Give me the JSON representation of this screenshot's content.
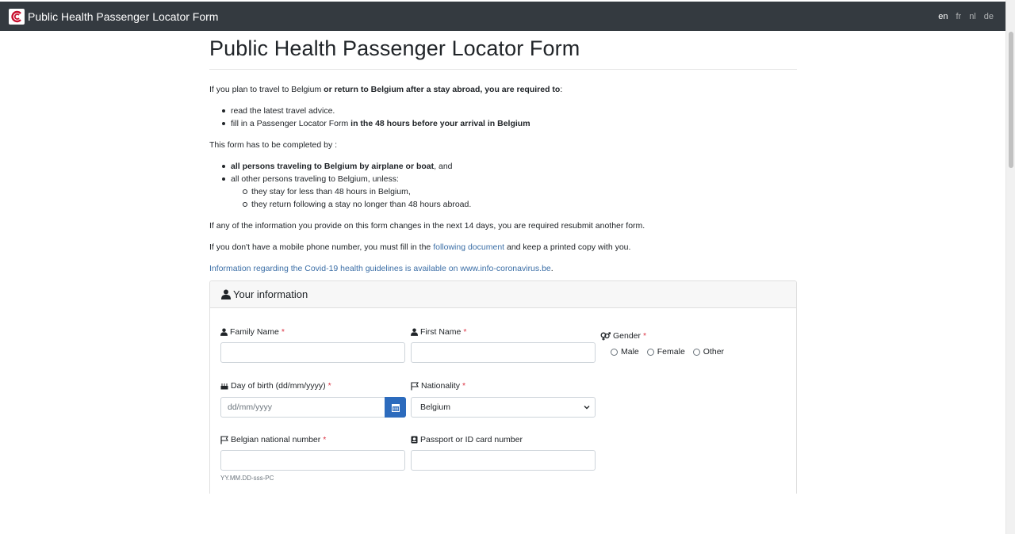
{
  "navbar": {
    "brand": "Public Health Passenger Locator Form",
    "languages": [
      "en",
      "fr",
      "nl",
      "de"
    ],
    "active_language": "en"
  },
  "page": {
    "title": "Public Health Passenger Locator Form",
    "intro_a": "If you plan to travel to Belgium ",
    "intro_b": "or return to Belgium after a stay abroad, you are required to",
    "intro_c": ":",
    "req1": "read the latest travel advice.",
    "req2_a": "fill in a Passenger Locator Form ",
    "req2_b": "in the 48 hours before your arrival in Belgium",
    "completed_by": "This form has to be completed by :",
    "cb1_a": "all persons traveling to Belgium by airplane or boat",
    "cb1_b": ", and",
    "cb2": "all other persons traveling to Belgium, unless:",
    "ex1": "they stay for less than 48 hours in Belgium,",
    "ex2": "they return following a stay no longer than 48 hours abroad.",
    "changes": "If any of the information you provide on this form changes in the next 14 days, you are required resubmit another form.",
    "nophone_a": "If you don't have a mobile phone number, you must fill in the ",
    "nophone_link": "following document",
    "nophone_b": " and keep a printed copy with you.",
    "covid_link": "Information regarding the Covid-19 health guidelines is available on www.info-coronavirus.be",
    "covid_dot": "."
  },
  "card": {
    "title": "Your information",
    "family_name": "Family Name",
    "first_name": "First Name",
    "gender": "Gender",
    "gender_options": [
      "Male",
      "Female",
      "Other"
    ],
    "dob": "Day of birth (dd/mm/yyyy)",
    "dob_placeholder": "dd/mm/yyyy",
    "nationality": "Nationality",
    "nationality_value": "Belgium",
    "national_number": "Belgian national number",
    "national_number_help": "YY.MM.DD-sss-PC",
    "passport": "Passport or ID card number",
    "required_mark": "*"
  }
}
